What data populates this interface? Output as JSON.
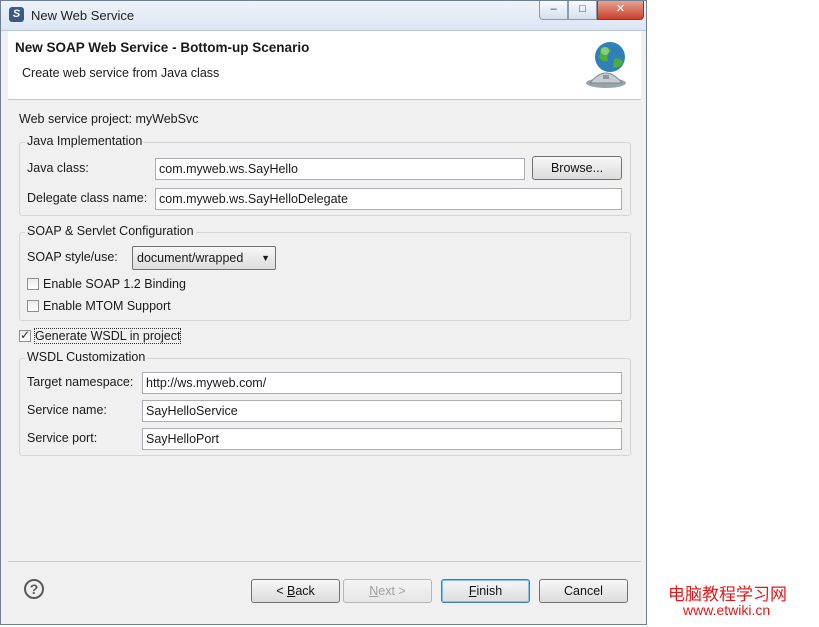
{
  "window": {
    "title": "New Web Service",
    "controls": {
      "minimize": "–",
      "maximize": "□",
      "close": "✕"
    }
  },
  "header": {
    "title": "New SOAP Web Service - Bottom-up Scenario",
    "subtitle": "Create web service from Java class",
    "icon": "globe-service-icon"
  },
  "project": {
    "label": "Web service project: myWebSvc"
  },
  "java_impl": {
    "legend": "Java Implementation",
    "java_class_label": "Java class:",
    "java_class_value": "com.myweb.ws.SayHello",
    "browse_label": "Browse...",
    "delegate_label": "Delegate class name:",
    "delegate_value": "com.myweb.ws.SayHelloDelegate"
  },
  "soap_config": {
    "legend": "SOAP & Servlet Configuration",
    "style_label": "SOAP style/use:",
    "style_value": "document/wrapped",
    "soap12_label": "Enable SOAP 1.2 Binding",
    "soap12_checked": false,
    "mtom_label": "Enable MTOM Support",
    "mtom_checked": false
  },
  "generate_wsdl": {
    "label": "Generate WSDL in project",
    "checked": true
  },
  "wsdl_custom": {
    "legend": "WSDL Customization",
    "namespace_label": "Target namespace:",
    "namespace_value": "http://ws.myweb.com/",
    "service_name_label": "Service name:",
    "service_name_value": "SayHelloService",
    "service_port_label": "Service port:",
    "service_port_value": "SayHelloPort"
  },
  "footer": {
    "help": "?",
    "back_pre": "< ",
    "back_key": "B",
    "back_post": "ack",
    "next_key": "N",
    "next_post": "ext >",
    "finish_key": "F",
    "finish_post": "inish",
    "cancel": "Cancel"
  },
  "watermark": {
    "line1": "电脑教程学习网",
    "line2": "www.etwiki.cn"
  }
}
